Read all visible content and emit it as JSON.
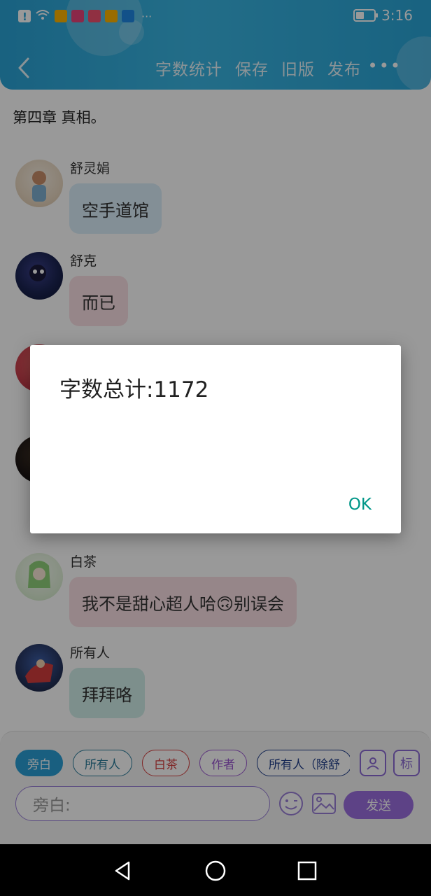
{
  "status_bar": {
    "time": "3:16",
    "battery_level": 0.45,
    "notification_icons": [
      "alert-icon",
      "wifi-icon",
      "weibo-icon",
      "bookstore-icon",
      "book-icon",
      "reader-icon",
      "weibo-icon",
      "lightbulb-icon"
    ],
    "overflow": "···"
  },
  "header": {
    "actions": [
      "字数统计",
      "保存",
      "旧版",
      "发布"
    ],
    "more": "•••"
  },
  "chapter_title": "第四章  真相。",
  "messages": [
    {
      "name": "舒灵娟",
      "text": "空手道馆",
      "bubble_color": "#dbeefb",
      "avatar_color": "#f2e7d8"
    },
    {
      "name": "舒克",
      "text": "而已",
      "bubble_color": "#fbe0e4",
      "avatar_color": "#1b2452"
    },
    {
      "name": "白茶",
      "text": "我不是甜心超人哈🙃别误会",
      "bubble_color": "#fbe0e4",
      "avatar_color": "#e9f4e6"
    },
    {
      "name": "所有人",
      "text": "拜拜咯",
      "bubble_color": "#d1eeea",
      "avatar_color": "#26345e"
    }
  ],
  "dialog": {
    "message": "字数总计:1172",
    "ok_label": "OK"
  },
  "composer": {
    "chips": [
      {
        "label": "旁白",
        "color": "#2a9fd6",
        "filled": true
      },
      {
        "label": "所有人",
        "color": "#2b7c9a",
        "filled": false
      },
      {
        "label": "白茶",
        "color": "#d64040",
        "filled": false
      },
      {
        "label": "作者",
        "color": "#9b59d0",
        "filled": false
      },
      {
        "label": "所有人（除舒",
        "color": "#1f3d8a",
        "filled": false
      }
    ],
    "tool_mark_label": "标",
    "input_placeholder": "旁白:",
    "send_label": "发送"
  },
  "colors": {
    "header": "#35b0e0",
    "dialog_ok": "#009688",
    "send": "#9b6fe0"
  }
}
